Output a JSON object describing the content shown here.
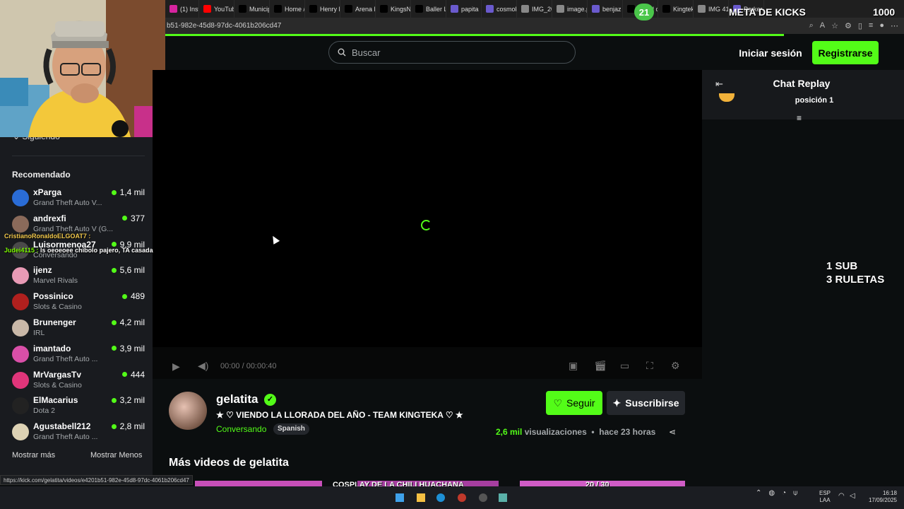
{
  "browser": {
    "tabs": [
      {
        "label": "(1) Insta",
        "icon": "instagram-icon",
        "color": "#d6249f"
      },
      {
        "label": "YouTub",
        "icon": "youtube-icon",
        "color": "#ff0000"
      },
      {
        "label": "Municip",
        "icon": "x-icon",
        "color": "#000000"
      },
      {
        "label": "Home /",
        "icon": "x-icon",
        "color": "#000000"
      },
      {
        "label": "Henry F",
        "icon": "x-icon",
        "color": "#000000"
      },
      {
        "label": "Arena K",
        "icon": "x-icon",
        "color": "#000000"
      },
      {
        "label": "KingsN",
        "icon": "x-icon",
        "color": "#000000"
      },
      {
        "label": "Baller L",
        "icon": "x-icon",
        "color": "#000000"
      },
      {
        "label": "papita",
        "icon": "web-icon",
        "color": "#6a5acd"
      },
      {
        "label": "cosmok",
        "icon": "web-icon",
        "color": "#6a5acd"
      },
      {
        "label": "IMG_20",
        "icon": "globe-icon",
        "color": "#888888"
      },
      {
        "label": "image.p",
        "icon": "globe-icon",
        "color": "#888888"
      },
      {
        "label": "benjaz",
        "icon": "web-icon",
        "color": "#6a5acd"
      },
      {
        "label": "Angel c",
        "icon": "x-icon",
        "color": "#000000"
      },
      {
        "label": "Kingtek",
        "icon": "tiktok-icon",
        "color": "#000000"
      },
      {
        "label": "IMG 41",
        "icon": "globe-icon",
        "color": "#888888"
      },
      {
        "label": "Parker",
        "icon": "web-icon",
        "color": "#6a5acd"
      }
    ],
    "url": "b51-982e-45d8-97dc-4061b206cd47",
    "status_url": "https://kick.com/gelatita/videos/e4201b51-982e-45d8-97dc-4061b206cd47"
  },
  "header": {
    "search_placeholder": "Buscar",
    "login": "Iniciar sesión",
    "register": "Registrarse"
  },
  "sidebar": {
    "following_label": "Siguiendo",
    "recommended_label": "Recomendado",
    "channels": [
      {
        "name": "xParga",
        "category": "Grand Theft Auto V...",
        "viewers": "1,4 mil",
        "color": "#2a6cd6"
      },
      {
        "name": "andrexfi",
        "category": "Grand Theft Auto V (G...",
        "viewers": "377",
        "color": "#8a6a5a"
      },
      {
        "name": "Luisormenoa27",
        "category": "Conversando",
        "viewers": "9,9 mil",
        "color": "#4a4a4a"
      },
      {
        "name": "ijenz",
        "category": "Marvel Rivals",
        "viewers": "5,6 mil",
        "color": "#e89ab5"
      },
      {
        "name": "Possinico",
        "category": "Slots & Casino",
        "viewers": "489",
        "color": "#b0201e"
      },
      {
        "name": "Brunenger",
        "category": "IRL",
        "viewers": "4,2 mil",
        "color": "#c9b8a8"
      },
      {
        "name": "imantado",
        "category": "Grand Theft Auto ...",
        "viewers": "3,9 mil",
        "color": "#d94fa8"
      },
      {
        "name": "MrVargasTv",
        "category": "Slots & Casino",
        "viewers": "444",
        "color": "#e0357a"
      },
      {
        "name": "ElMacarius",
        "category": "Dota 2",
        "viewers": "3,2 mil",
        "color": "#222222"
      },
      {
        "name": "Agustabell212",
        "category": "Grand Theft Auto ...",
        "viewers": "2,8 mil",
        "color": "#ddd2b4"
      }
    ],
    "show_more": "Mostrar más",
    "show_less": "Mostrar Menos"
  },
  "player": {
    "time": "00:00 / 00:00:40"
  },
  "chat": {
    "title": "Chat Replay",
    "position_text": "posición 1"
  },
  "video": {
    "username": "gelatita",
    "title": "★ ♡ VIENDO LA LLORADA DEL AÑO - TEAM KINGTEKA ♡ ★",
    "category": "Conversando",
    "language": "Spanish",
    "follow": "Seguir",
    "subscribe": "Suscribirse",
    "views_count": "2,6 mil",
    "views_label": "visualizaciones",
    "age": "hace 23 horas",
    "separator": "•",
    "more_videos": "Más videos de gelatita"
  },
  "overlays": {
    "goal_title": "META DE KICKS",
    "goal_number": "1000",
    "badge": "21",
    "sub_line1": "1 SUB",
    "sub_line2": "3 RULETAS",
    "chat1_user": "CristianoRonaldoELGOAT7 :",
    "chat2_user": "Judei4115 :",
    "chat2_msg": "ls oeoeoee chibolo pajero, TA casada",
    "goal_text": "COSPLAY DE LA CHILI HUACHANA",
    "goal_count": "20 / 30",
    "goal_progress": 0.667
  },
  "taskbar": {
    "lang1": "ESP",
    "lang2": "LAA",
    "time": "16:18",
    "date": "17/09/2025"
  },
  "colors": {
    "accent": "#53fc18",
    "background": "#0b0e0f",
    "sidebar": "#191b1f"
  }
}
